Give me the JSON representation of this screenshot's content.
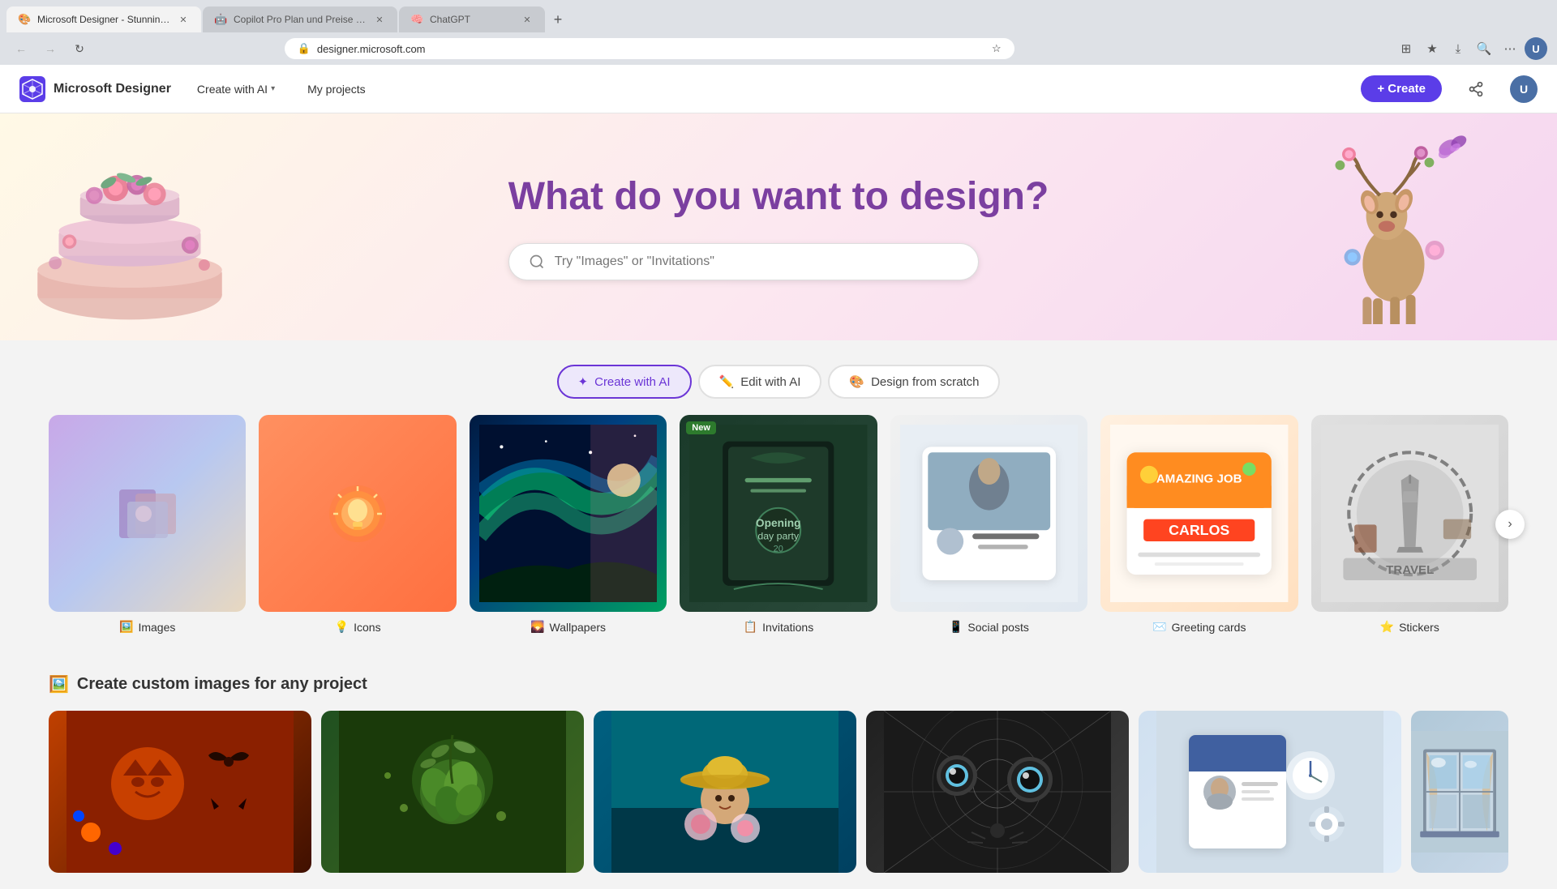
{
  "browser": {
    "tabs": [
      {
        "id": "tab1",
        "label": "Microsoft Designer - Stunning ...",
        "active": true,
        "favicon": "🎨"
      },
      {
        "id": "tab2",
        "label": "Copilot Pro Plan und Preise – F...",
        "active": false,
        "favicon": "🤖"
      },
      {
        "id": "tab3",
        "label": "ChatGPT",
        "active": false,
        "favicon": "🧠"
      }
    ],
    "url": "designer.microsoft.com"
  },
  "nav": {
    "logo_text": "Microsoft Designer",
    "menu_items": [
      {
        "id": "create-with-ai",
        "label": "Create with AI",
        "has_dropdown": true
      },
      {
        "id": "my-projects",
        "label": "My projects",
        "has_dropdown": false
      }
    ],
    "create_btn_label": "+ Create",
    "share_icon": "share",
    "user_icon": "user"
  },
  "hero": {
    "title": "What do you want to design?",
    "search_placeholder": "Try \"Images\" or \"Invitations\""
  },
  "filter_tabs": [
    {
      "id": "create-ai",
      "label": "Create with AI",
      "icon": "✦",
      "active": true
    },
    {
      "id": "edit-ai",
      "label": "Edit with AI",
      "icon": "✏️",
      "active": false
    },
    {
      "id": "design-scratch",
      "label": "Design from scratch",
      "icon": "🎨",
      "active": false
    }
  ],
  "categories": [
    {
      "id": "images",
      "label": "Images",
      "icon": "🖼️",
      "bg": "thumb-images",
      "new": false
    },
    {
      "id": "icons",
      "label": "Icons",
      "icon": "💡",
      "bg": "thumb-icons",
      "new": false
    },
    {
      "id": "wallpapers",
      "label": "Wallpapers",
      "icon": "🌄",
      "bg": "thumb-wallpapers",
      "new": false
    },
    {
      "id": "invitations",
      "label": "Invitations",
      "icon": "📋",
      "bg": "thumb-invitations",
      "new": true
    },
    {
      "id": "social-posts",
      "label": "Social posts",
      "icon": "📱",
      "bg": "thumb-social",
      "new": false
    },
    {
      "id": "greeting-cards",
      "label": "Greeting cards",
      "icon": "✉️",
      "bg": "thumb-greeting",
      "new": false
    },
    {
      "id": "stickers",
      "label": "Stickers",
      "icon": "⭐",
      "bg": "thumb-stickers",
      "new": false
    }
  ],
  "custom_images_section": {
    "title": "Create custom images for any project",
    "icon": "🖼️",
    "images": [
      {
        "id": "halloween",
        "bg": "thumb-halloween"
      },
      {
        "id": "olives",
        "bg": "thumb-olives"
      },
      {
        "id": "sombrero",
        "bg": "thumb-sombrero"
      },
      {
        "id": "spiderweb",
        "bg": "thumb-spiderweb"
      },
      {
        "id": "tech",
        "bg": "thumb-tech"
      },
      {
        "id": "window",
        "bg": "thumb-window"
      }
    ]
  },
  "labels": {
    "new_badge": "New",
    "scroll_next": "›"
  }
}
